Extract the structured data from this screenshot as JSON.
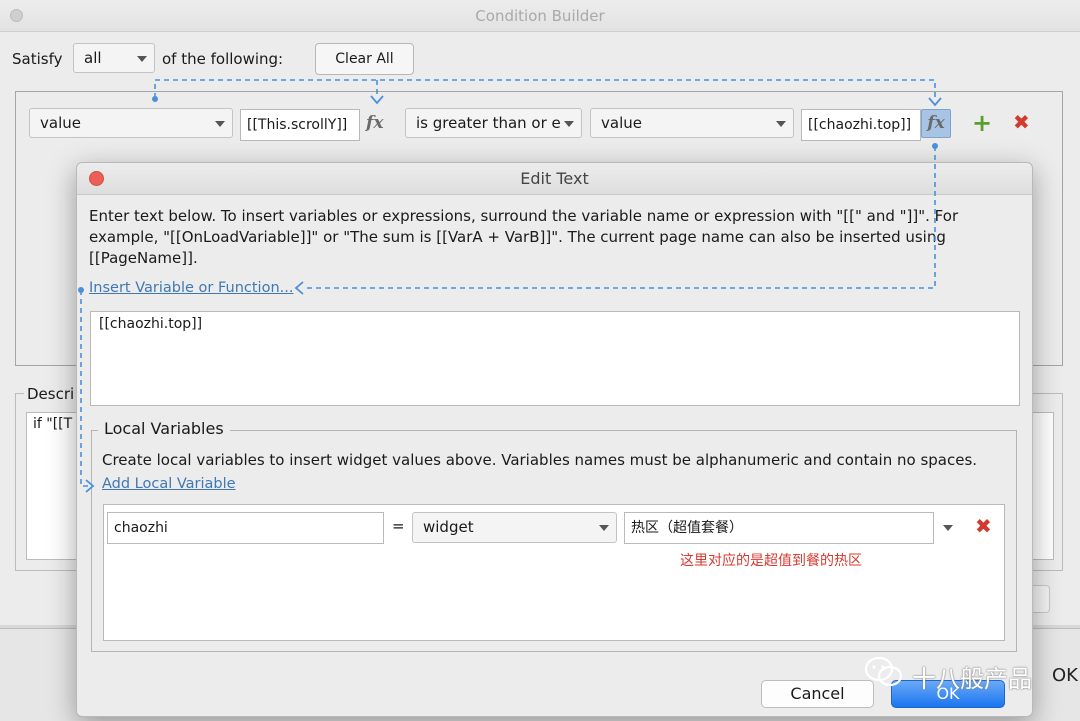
{
  "condition_builder": {
    "title": "Condition Builder",
    "satisfy_label": "Satisfy",
    "satisfy_value": "all",
    "of_following_label": "of the following:",
    "clear_all_label": "Clear All",
    "row": {
      "left_type": "value",
      "left_value": "[[This.scrollY]]",
      "fx_label": "fx",
      "operator": "is greater than or e",
      "right_type": "value",
      "right_value": "[[chaozhi.top]]",
      "right_fx_label": "fx",
      "add_glyph": "+",
      "remove_glyph": "✖"
    },
    "description_label": "Descri",
    "description_text": "if \"[[T",
    "ok_partial": "OK"
  },
  "edit_text": {
    "title": "Edit Text",
    "instructions": "Enter text below. To insert variables or expressions, surround the variable name or expression with \"[[\" and \"]]\". For example, \"[[OnLoadVariable]]\" or \"The sum is [[VarA + VarB]]\". The current page name can also be inserted using [[PageName]].",
    "insert_link": "Insert Variable or Function...",
    "text_value": "[[chaozhi.top]]",
    "local_variables": {
      "legend": "Local Variables",
      "description": "Create local variables to insert widget values above. Variables names must be alphanumeric and contain no spaces.",
      "add_link": "Add Local Variable",
      "row": {
        "name": "chaozhi",
        "equals": "=",
        "type": "widget",
        "target": "热区（超值套餐）",
        "remove_glyph": "✖"
      },
      "annotation": "这里对应的是超值到餐的热区"
    },
    "cancel_label": "Cancel",
    "ok_label": "OK"
  },
  "watermark": "十八般产品",
  "colors": {
    "accent_blue": "#1a75f0",
    "annotation_arrow": "#4a8fdc",
    "danger_red": "#d23a2e",
    "add_green": "#5a9e2c",
    "link_blue": "#3f78b3"
  }
}
